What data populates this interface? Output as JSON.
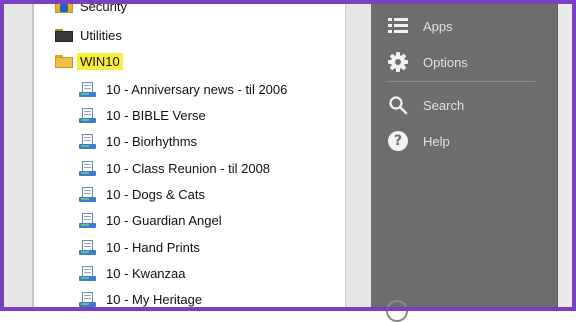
{
  "tree": {
    "partial_top_label": "Security",
    "folders": [
      {
        "label": "Utilities"
      },
      {
        "label": "WIN10"
      }
    ],
    "items": [
      {
        "label": "10 - Anniversary news - til 2006"
      },
      {
        "label": "10 - BIBLE Verse"
      },
      {
        "label": "10 - Biorhythms"
      },
      {
        "label": "10 - Class Reunion - til 2008"
      },
      {
        "label": "10 - Dogs & Cats"
      },
      {
        "label": "10 - Guardian Angel"
      },
      {
        "label": "10 - Hand Prints"
      },
      {
        "label": "10 - Kwanzaa"
      },
      {
        "label": "10 - My Heritage"
      }
    ]
  },
  "menu": {
    "apps_label": "Apps",
    "options_label": "Options",
    "search_label": "Search",
    "help_label": "Help",
    "help_glyph": "?"
  },
  "colors": {
    "frame": "#7b3fc4",
    "selection": "#f9ef3b",
    "menu_bg": "#6d6d6d",
    "menu_text": "#e2e2e2"
  }
}
